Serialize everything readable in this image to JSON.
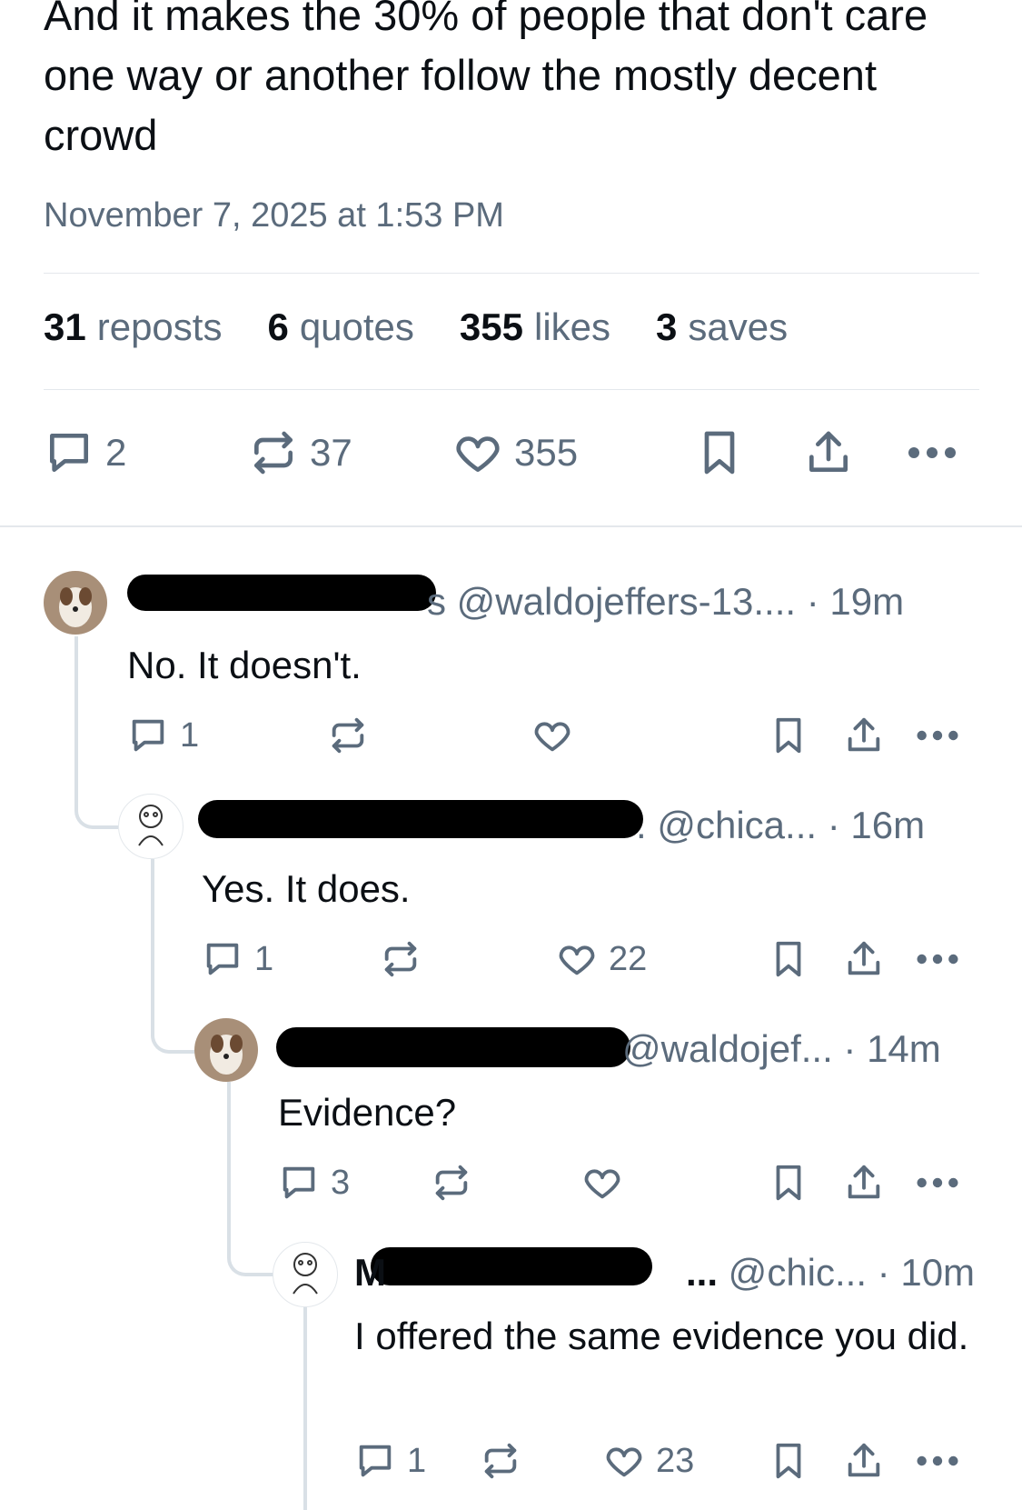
{
  "post": {
    "text": "And it makes the 30% of people that don't care one way or another follow the mostly decent crowd",
    "timestamp": "November 7, 2025 at 1:53 PM"
  },
  "stats": [
    {
      "count": "31",
      "label": "reposts"
    },
    {
      "count": "6",
      "label": "quotes"
    },
    {
      "count": "355",
      "label": "likes"
    },
    {
      "count": "3",
      "label": "saves"
    }
  ],
  "main_actions": {
    "replies": "2",
    "reposts": "37",
    "likes": "355"
  },
  "replies": [
    {
      "handle": "s @waldojeffers-13.... · 19m",
      "text": "No. It doesn't.",
      "reply_count": "1",
      "like_count": ""
    },
    {
      "handle": ". @chica... · 16m",
      "text": "Yes. It does.",
      "reply_count": "1",
      "like_count": "22"
    },
    {
      "handle": "@waldojef... · 14m",
      "text": "Evidence?",
      "reply_count": "3",
      "like_count": ""
    },
    {
      "handle": "M ... @chic... · 10m",
      "text": "I offered the same evidence you did.",
      "reply_count": "1",
      "like_count": "23"
    }
  ],
  "colors": {
    "muted": "#5b6b7c",
    "text": "#0b0f14",
    "line": "#d9e0e6"
  }
}
